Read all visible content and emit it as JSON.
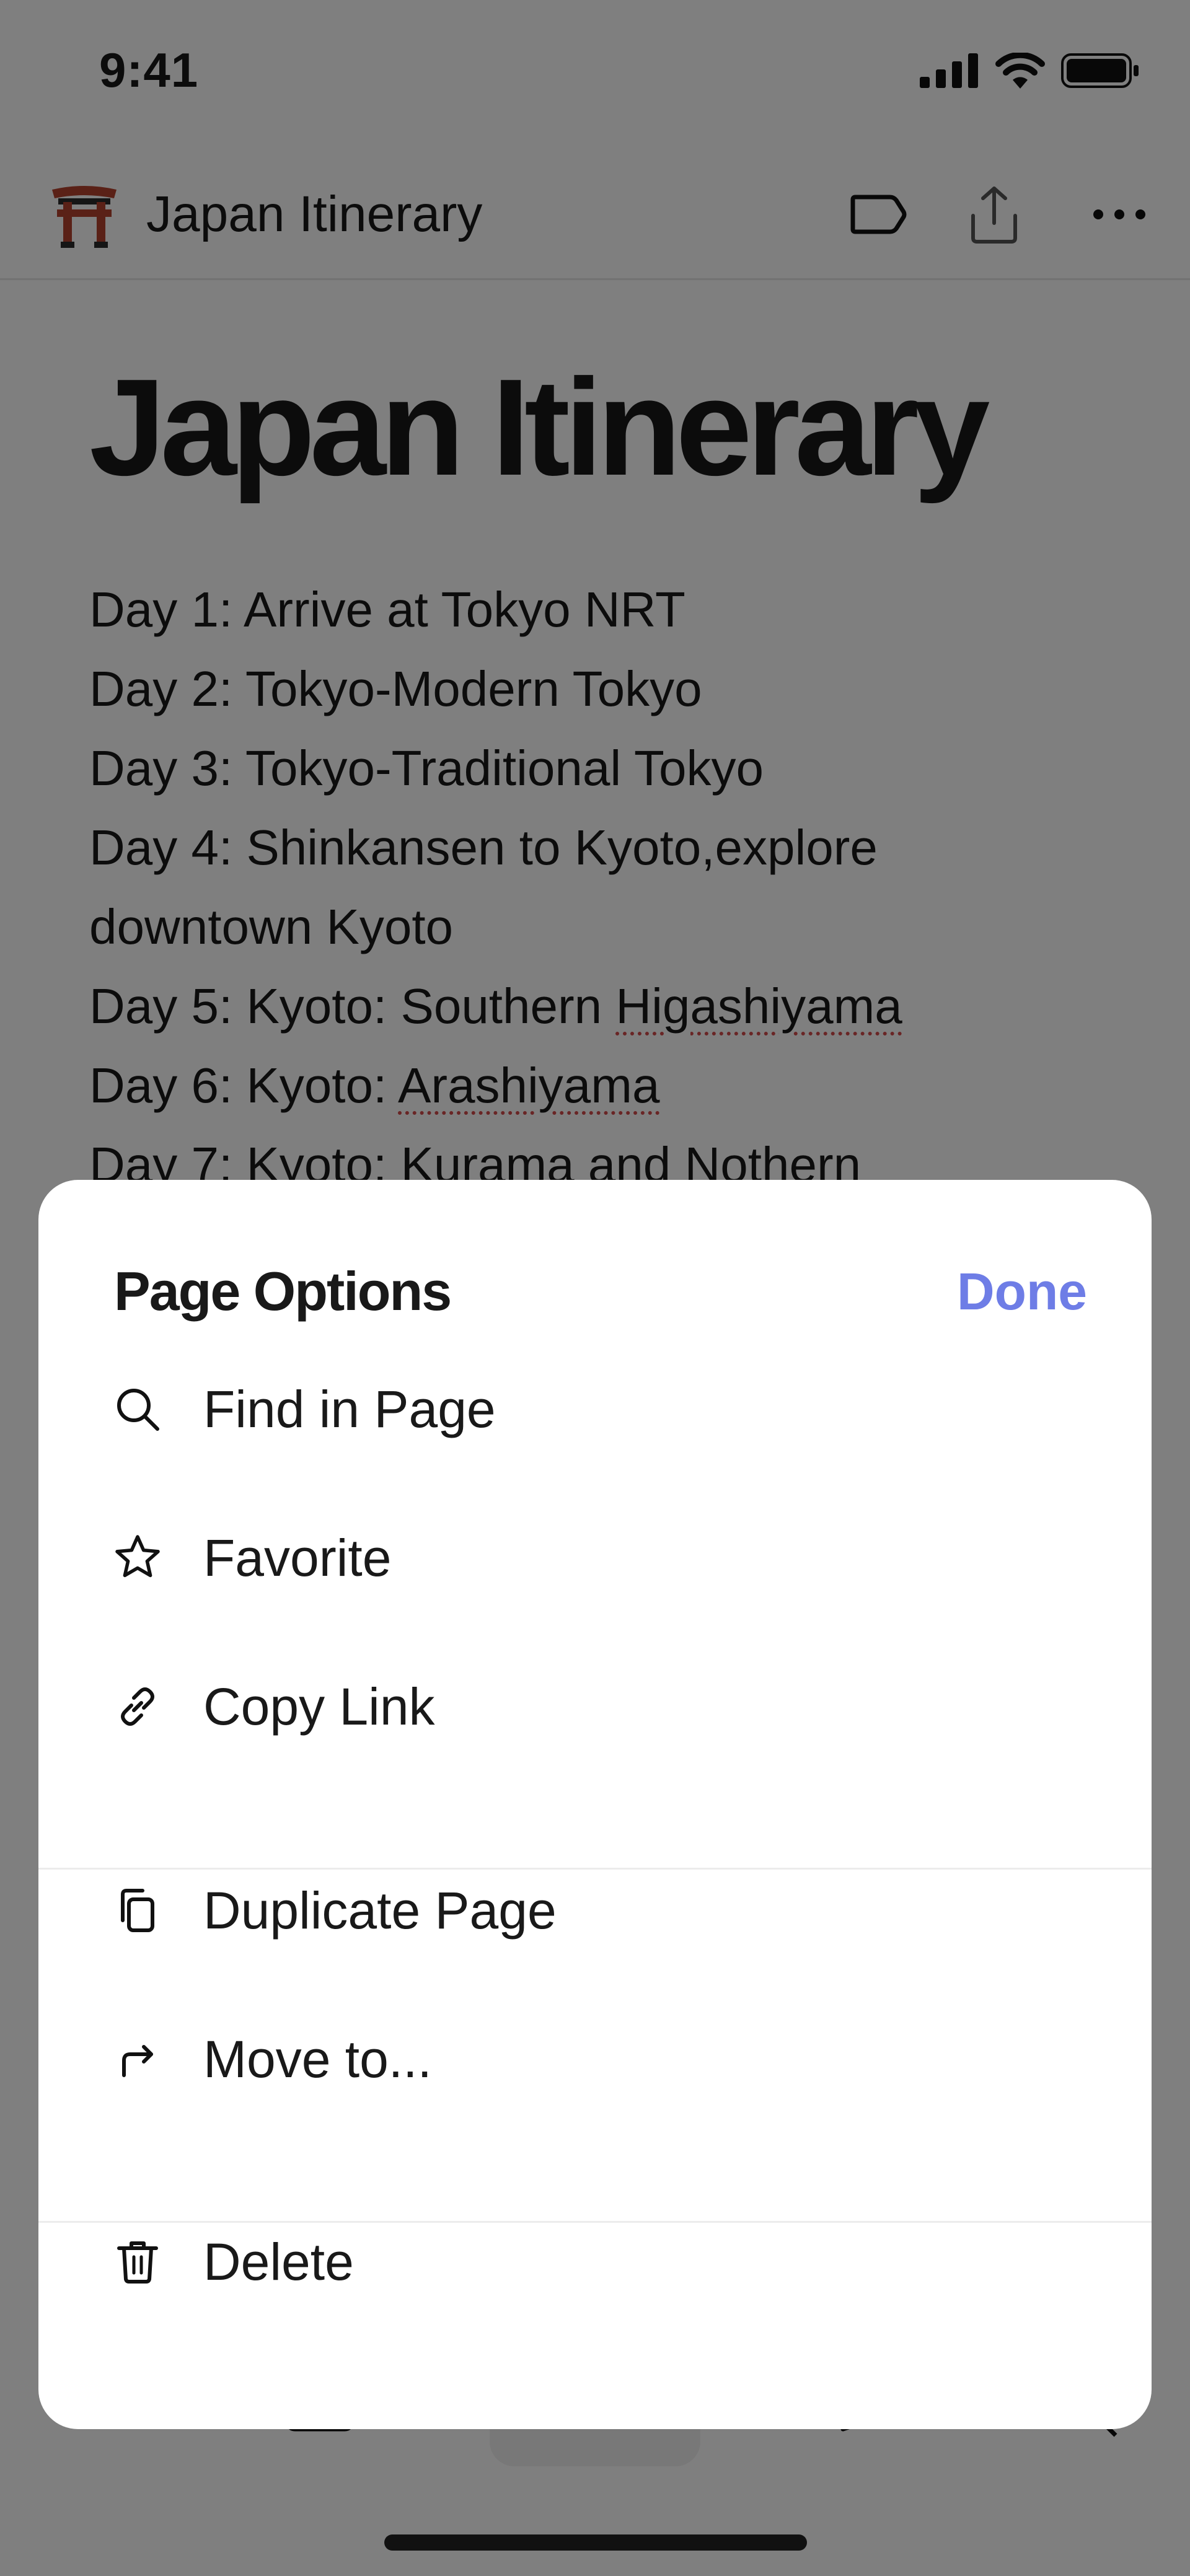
{
  "status_bar": {
    "time": "9:41"
  },
  "header": {
    "title": "Japan Itinerary",
    "page_emoji": "torii-gate-emoji"
  },
  "document": {
    "title": "Japan Itinerary",
    "lines": [
      "Day 1: Arrive at Tokyo NRT",
      "Day 2: Tokyo-Modern Tokyo",
      "Day 3: Tokyo-Traditional Tokyo",
      "Day 4: Shinkansen to Kyoto,explore",
      "downtown Kyoto",
      {
        "prefix": "Day 5: Kyoto: Southern ",
        "flagged": "Higashiyama"
      },
      {
        "prefix": "Day 6: Kyoto: ",
        "flagged": "Arashiyama"
      },
      "Day 7: Kyoto: Kurama and Nothern"
    ]
  },
  "sheet": {
    "title": "Page Options",
    "done_label": "Done",
    "groups": [
      [
        {
          "label": "Find in Page",
          "icon": "search-icon"
        },
        {
          "label": "Favorite",
          "icon": "star-icon"
        },
        {
          "label": "Copy Link",
          "icon": "link-icon"
        }
      ],
      [
        {
          "label": "Duplicate Page",
          "icon": "duplicate-icon"
        },
        {
          "label": "Move to...",
          "icon": "move-arrow-icon"
        }
      ],
      [
        {
          "label": "Delete",
          "icon": "trash-icon"
        }
      ]
    ]
  },
  "colors": {
    "accent": "#6e7de6",
    "overlay": "rgba(0,0,0,0.5)",
    "torii": "#b5432f"
  }
}
